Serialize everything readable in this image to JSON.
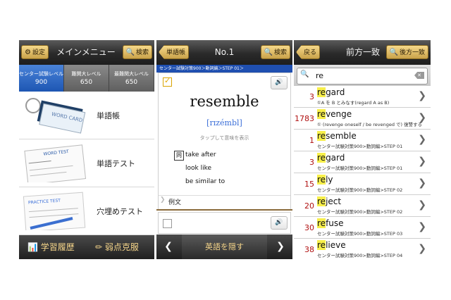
{
  "screen1": {
    "title": "メインメニュー",
    "settings_label": "設定",
    "search_label": "検索",
    "levels": [
      {
        "name": "センター試験レベル",
        "count": "900"
      },
      {
        "name": "難関大レベル",
        "count": "650"
      },
      {
        "name": "最難関大レベル",
        "count": "650"
      }
    ],
    "menu": [
      {
        "label": "単語帳",
        "art": "WORD CARD"
      },
      {
        "label": "単語テスト",
        "art": "WORD TEST"
      },
      {
        "label": "穴埋めテスト",
        "art": "PRACTICE TEST"
      }
    ],
    "bottom": {
      "history": "学習履歴",
      "weak": "弱点克服"
    }
  },
  "screen2": {
    "back_label": "単語帳",
    "title": "No.1",
    "search_label": "検索",
    "breadcrumb": "センター試験対策900＞動詞編＞STEP 01＞",
    "word": "resemble",
    "pronunciation": "[rɪzémbl]",
    "tap_hint": "タップして意味を表示",
    "synonym_badge": "同",
    "synonyms": [
      "take after",
      "look like",
      "be similar to"
    ],
    "example_label": "例文",
    "hide_label": "英語を隠す"
  },
  "screen3": {
    "back_label": "戻る",
    "title": "前方一致",
    "suffix_label": "後方一致",
    "query": "re",
    "results": [
      {
        "count": "3",
        "prefix": "re",
        "rest": "gard",
        "sub": "①A を B とみなす(regard A as B)"
      },
      {
        "count": "1783",
        "prefix": "re",
        "rest": "venge",
        "sub": "① (revenge oneself / be revenged で) 復讐する"
      },
      {
        "count": "1",
        "prefix": "re",
        "rest": "semble",
        "sub": "センター試験対策900>動詞編>STEP 01"
      },
      {
        "count": "3",
        "prefix": "re",
        "rest": "gard",
        "sub": "センター試験対策900>動詞編>STEP 01"
      },
      {
        "count": "15",
        "prefix": "re",
        "rest": "ly",
        "sub": "センター試験対策900>動詞編>STEP 02"
      },
      {
        "count": "20",
        "prefix": "re",
        "rest": "ject",
        "sub": "センター試験対策900>動詞編>STEP 02"
      },
      {
        "count": "30",
        "prefix": "re",
        "rest": "fuse",
        "sub": "センター試験対策900>動詞編>STEP 03"
      },
      {
        "count": "38",
        "prefix": "re",
        "rest": "lieve",
        "sub": "センター試験対策900>動詞編>STEP 04"
      }
    ]
  },
  "colors": {
    "gold": "#e2bb5f",
    "active_blue": "#2a63c4",
    "count_red": "#b01010",
    "highlight": "#f7ef4a"
  }
}
